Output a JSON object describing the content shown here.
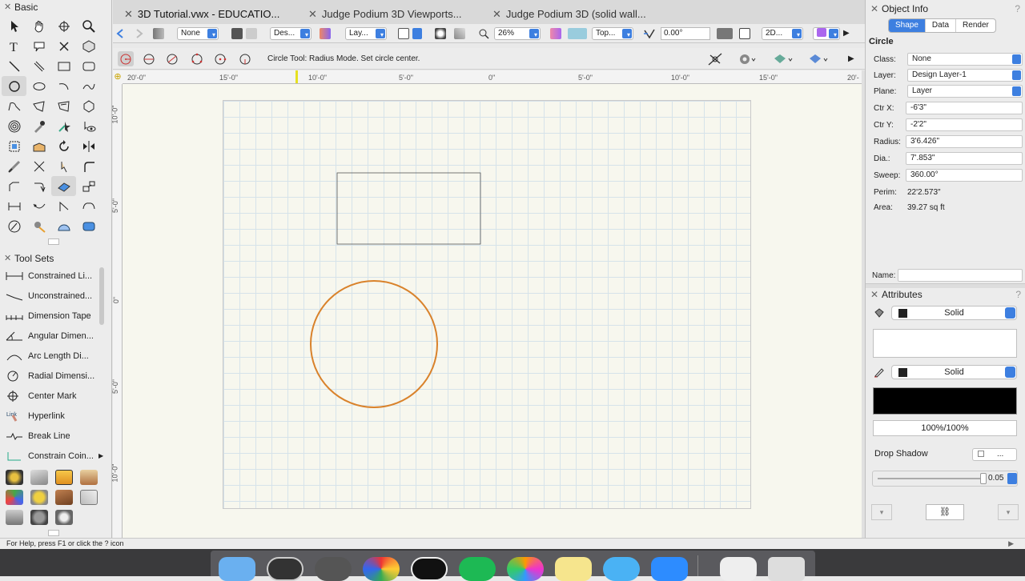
{
  "tabs": [
    {
      "label": "3D Tutorial.vwx - EDUCATIO...",
      "active": true
    },
    {
      "label": "Judge Podium 3D Viewports...",
      "active": false
    },
    {
      "label": "Judge Podium 3D (solid wall...",
      "active": false
    }
  ],
  "toolbar": {
    "class_value": "None",
    "layer_set_value": "Des...",
    "layer_value": "Lay...",
    "zoom": "26%",
    "view": "Top...",
    "rotation": "0.00°",
    "render_mode": "2D..."
  },
  "modebar": {
    "help_text": "Circle Tool: Radius Mode. Set circle center."
  },
  "rulers": {
    "horizontal": [
      "20'-0\"",
      "15'-0\"",
      "10'-0\"",
      "5'-0\"",
      "0\"",
      "5'-0\"",
      "10'-0\"",
      "15'-0\"",
      "20'-"
    ],
    "vertical": [
      "10'-0\"",
      "5'-0\"",
      "0\"",
      "5'-0\"",
      "10'-0\""
    ]
  },
  "left_palette": {
    "basic_title": "Basic",
    "toolsets_title": "Tool Sets",
    "toolset_items": [
      "Constrained Li...",
      "Unconstrained...",
      "Dimension Tape",
      "Angular Dimen...",
      "Arc Length Di...",
      "Radial Dimensi...",
      "Center Mark",
      "Hyperlink",
      "Break Line",
      "Constrain Coin..."
    ]
  },
  "object_info": {
    "title": "Object Info",
    "tabs": [
      "Shape",
      "Data",
      "Render"
    ],
    "object_type": "Circle",
    "class_label": "Class:",
    "class_value": "None",
    "layer_label": "Layer:",
    "layer_value": "Design Layer-1",
    "plane_label": "Plane:",
    "plane_value": "Layer",
    "ctrx_label": "Ctr X:",
    "ctrx_value": "-6'3\"",
    "ctry_label": "Ctr Y:",
    "ctry_value": "-2'2\"",
    "radius_label": "Radius:",
    "radius_value": "3'6.426\"",
    "dia_label": "Dia.:",
    "dia_value": "7'.853\"",
    "sweep_label": "Sweep:",
    "sweep_value": "360.00°",
    "perim_label": "Perim:",
    "perim_value": "22'2.573\"",
    "area_label": "Area:",
    "area_value": "39.27 sq ft",
    "name_label": "Name:",
    "name_value": ""
  },
  "attributes": {
    "title": "Attributes",
    "fill_style": "Solid",
    "pen_style": "Solid",
    "opacity": "100%/100%",
    "drop_shadow_label": "Drop Shadow",
    "drop_shadow_more": "...",
    "line_weight": "0.05"
  },
  "status_bar": {
    "help": "For Help, press F1 or click the ? icon"
  },
  "colors": {
    "circle_stroke": "#d9822b",
    "accent": "#3d7fe0",
    "canvas_bg": "#f7f7ee"
  }
}
